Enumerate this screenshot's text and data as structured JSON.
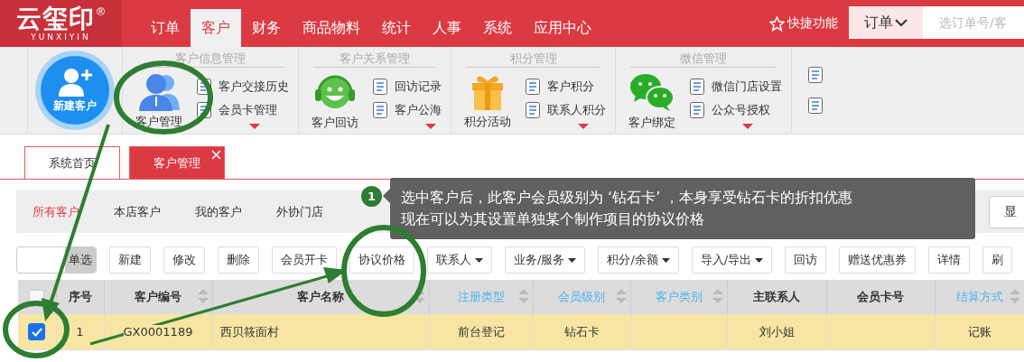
{
  "logo": {
    "text": "云玺印",
    "mark": "®",
    "subtitle": "YUNXIYIN"
  },
  "nav": [
    {
      "label": "订单",
      "selected": false
    },
    {
      "label": "客户",
      "selected": true
    },
    {
      "label": "财务",
      "selected": false
    },
    {
      "label": "商品物料",
      "selected": false
    },
    {
      "label": "统计",
      "selected": false
    },
    {
      "label": "人事",
      "selected": false
    },
    {
      "label": "系统",
      "selected": false
    },
    {
      "label": "应用中心",
      "selected": false
    }
  ],
  "quick": {
    "label": "快捷功能"
  },
  "global_search": {
    "scope": "订单",
    "placeholder": "选订单号/客"
  },
  "ribbon": {
    "new_button": "新建客户",
    "groups": [
      {
        "title": "客户信息管理",
        "main": {
          "label": "客户管理"
        },
        "items": [
          "客户交接历史",
          "会员卡管理"
        ]
      },
      {
        "title": "客户关系管理",
        "main": {
          "label": "客户回访"
        },
        "items": [
          "回访记录",
          "客户公海"
        ]
      },
      {
        "title": "积分管理",
        "main": {
          "label": "积分活动"
        },
        "items": [
          "客户积分",
          "联系人积分"
        ]
      },
      {
        "title": "微信管理",
        "main": {
          "label": "客户绑定"
        },
        "items": [
          "微信门店设置",
          "公众号授权"
        ]
      }
    ]
  },
  "tabs": [
    {
      "label": "系统首页",
      "selected": false,
      "closable": false
    },
    {
      "label": "客户管理",
      "selected": true,
      "closable": true
    }
  ],
  "filters": [
    {
      "label": "所有客户",
      "selected": true
    },
    {
      "label": "本店客户",
      "selected": false
    },
    {
      "label": "我的客户",
      "selected": false
    },
    {
      "label": "外协门店",
      "selected": false
    }
  ],
  "search": {
    "extra_button": "显"
  },
  "toolbar": {
    "toggle": "单选",
    "buttons": [
      {
        "label": "新建",
        "dropdown": false
      },
      {
        "label": "修改",
        "dropdown": false
      },
      {
        "label": "删除",
        "dropdown": false
      },
      {
        "label": "会员开卡",
        "dropdown": false
      },
      {
        "label": "协议价格",
        "dropdown": false
      },
      {
        "label": "联系人",
        "dropdown": true
      },
      {
        "label": "业务/服务",
        "dropdown": true
      },
      {
        "label": "积分/余额",
        "dropdown": true
      },
      {
        "label": "导入/导出",
        "dropdown": true
      },
      {
        "label": "回访",
        "dropdown": false
      },
      {
        "label": "赠送优惠券",
        "dropdown": false
      },
      {
        "label": "详情",
        "dropdown": false
      },
      {
        "label": "刷",
        "dropdown": false
      }
    ]
  },
  "table": {
    "all_checked": false,
    "columns": [
      {
        "label": "序号",
        "sortable": false,
        "accent": false
      },
      {
        "label": "客户编号",
        "sortable": true,
        "accent": false
      },
      {
        "label": "客户名称",
        "sortable": true,
        "accent": false
      },
      {
        "label": "注册类型",
        "sortable": true,
        "accent": true
      },
      {
        "label": "会员级别",
        "sortable": true,
        "accent": true
      },
      {
        "label": "客户类别",
        "sortable": true,
        "accent": true
      },
      {
        "label": "主联系人",
        "sortable": false,
        "accent": false
      },
      {
        "label": "会员卡号",
        "sortable": false,
        "accent": false
      },
      {
        "label": "结算方式",
        "sortable": true,
        "accent": true
      }
    ],
    "rows": [
      {
        "checked": true,
        "selected": true,
        "cells": [
          "1",
          "GX0001189",
          "西贝筱面村",
          "前台登记",
          "钻石卡",
          "",
          "刘小姐",
          "",
          "记账"
        ]
      }
    ]
  },
  "callout": {
    "badge": "1",
    "lines": [
      "选中客户后，此客户会员级别为 ‘钻石卡’ ，本身享受钻石卡的折扣优惠",
      "现在可以为其设置单独某个制作项目的协议价格"
    ]
  }
}
